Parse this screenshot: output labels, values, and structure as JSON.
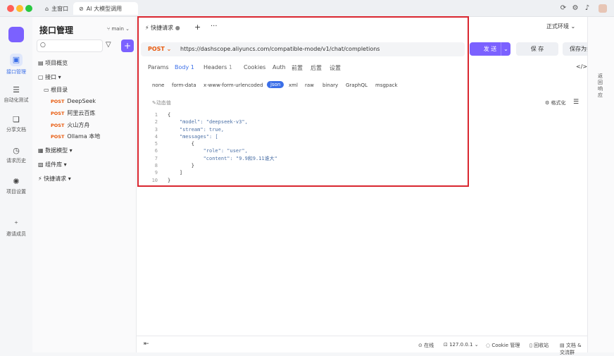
{
  "window": {
    "tabs": [
      {
        "label": "主窗口"
      },
      {
        "label": "AI 大模型调用"
      }
    ]
  },
  "sidebar": {
    "title": "接口管理",
    "branch": "main",
    "items": {
      "overview": "项目概览",
      "api": "接口",
      "root": "根目录",
      "data_model": "数据模型",
      "components": "组件库",
      "quick_req": "快捷请求"
    },
    "endpoints": [
      {
        "method": "POST",
        "name": "DeepSeek"
      },
      {
        "method": "POST",
        "name": "阿里云百炼"
      },
      {
        "method": "POST",
        "name": "火山方舟"
      },
      {
        "method": "POST",
        "name": "Ollama 本地"
      }
    ]
  },
  "leftbar": {
    "items": [
      {
        "label": "接口管理"
      },
      {
        "label": "自动化测试"
      },
      {
        "label": "分享文档"
      },
      {
        "label": "请求历史"
      },
      {
        "label": "项目设置"
      },
      {
        "label": "邀请成员"
      }
    ]
  },
  "main": {
    "tab_label": "快捷请求",
    "environment": "正式环境",
    "method": "POST",
    "url": "https://dashscope.aliyuncs.com/compatible-mode/v1/chat/completions",
    "send": "发 送",
    "save": "保 存",
    "save_as": "保存为接口",
    "req_tabs": [
      "Params",
      "Body",
      "1",
      "Headers",
      "1",
      "Cookies",
      "Auth",
      "前置",
      "后置",
      "设置"
    ],
    "body_types": [
      "none",
      "form-data",
      "x-www-form-urlencoded",
      "json",
      "xml",
      "raw",
      "binary",
      "GraphQL",
      "msgpack"
    ],
    "dynamic_value": "动态值",
    "format": "格式化",
    "response_label": "返回响应"
  },
  "code": [
    {
      "n": "1",
      "t": "{"
    },
    {
      "n": "2",
      "t": "    \"model\": \"deepseek-v3\","
    },
    {
      "n": "3",
      "t": "    \"stream\": true,"
    },
    {
      "n": "4",
      "t": "    \"messages\": ["
    },
    {
      "n": "5",
      "t": "        {"
    },
    {
      "n": "6",
      "t": "            \"role\": \"user\","
    },
    {
      "n": "7",
      "t": "            \"content\": \"9.9和9.11谁大\""
    },
    {
      "n": "8",
      "t": "        }"
    },
    {
      "n": "9",
      "t": "    ]"
    },
    {
      "n": "10",
      "t": "}"
    }
  ],
  "status": {
    "online": "在线",
    "host": "127.0.0.1",
    "cookie": "Cookie 管理",
    "trash": "回收站",
    "docs": "文档 & 交流群"
  }
}
